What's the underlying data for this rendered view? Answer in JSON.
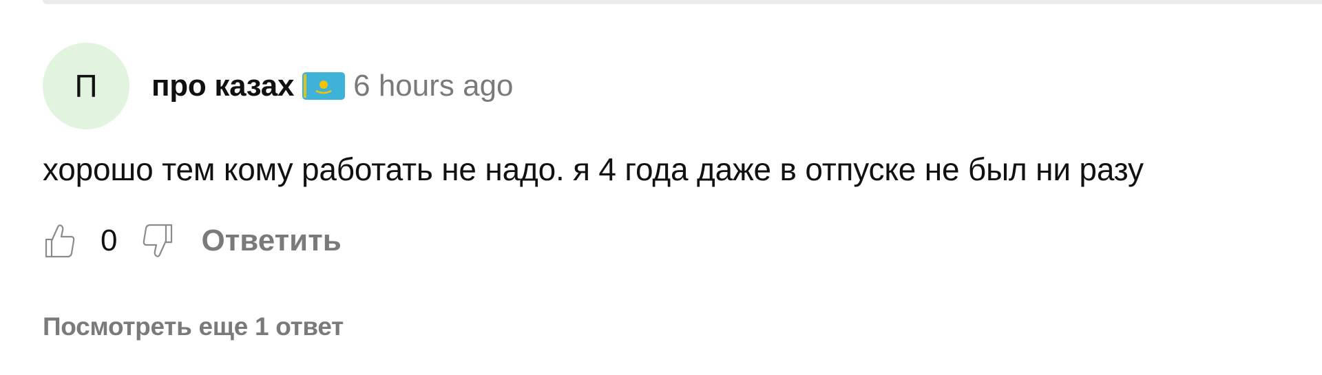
{
  "comment": {
    "avatar_initial": "П",
    "author": "про казах",
    "flag_icon": "kazakhstan-flag-icon",
    "timestamp": "6 hours ago",
    "text": "хорошо тем кому работать не надо. я 4 года даже в отпуске не был ни разу",
    "like_count": "0",
    "reply_label": "Ответить",
    "view_replies_label": "Посмотреть еще 1 ответ"
  },
  "colors": {
    "avatar_bg": "#e2f4df",
    "flag_blue": "#3fb2d9",
    "flag_gold": "#f2c500",
    "muted_text": "#7a7a7a"
  }
}
